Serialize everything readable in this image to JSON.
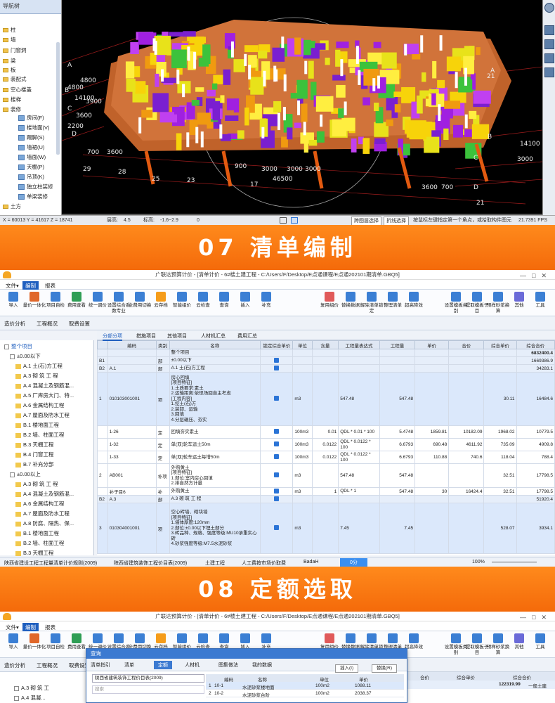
{
  "section1": {
    "nav_title": "导航树",
    "nav_items": [
      "柱",
      "墙",
      "门窗洞",
      "梁",
      "板",
      "装配式",
      "空心楼盖",
      "楼梯",
      "装修",
      "土方"
    ],
    "nav_sub_items": [
      "房间(F)",
      "楼地面(V)",
      "踢脚(S)",
      "墙裙(U)",
      "墙面(W)",
      "天棚(P)",
      "吊顶(K)",
      "独立柱装修",
      "单梁装修"
    ],
    "axis_labels": [
      "A",
      "B",
      "C",
      "D",
      "A",
      "B",
      "C",
      "D",
      "21",
      "21",
      "29",
      "28",
      "25",
      "23",
      "17",
      "700",
      "3600",
      "3600",
      "700",
      "900",
      "3000",
      "3000",
      "3000",
      "46500",
      "14100",
      "14100",
      "4800",
      "3900",
      "2200",
      "3600",
      "3000",
      "4800"
    ],
    "status": {
      "coords": "X = 60013 Y = 41617 Z = 18741",
      "floor_height_label": "层高:",
      "floor_height": "4.5",
      "elevation_label": "标高:",
      "elevation": "-1.6~2.9",
      "zero": "0",
      "btn1": "跨图层选择",
      "btn2": "折线选择",
      "hint": "按鼠标左键指定第一个角点，或拾取构件图元",
      "fps": "21.7391 FPS"
    }
  },
  "banner1": "07  清单编制",
  "banner2": "08  定额选取",
  "app": {
    "title": "广联达预算计价 - [清单计价 - 6#楼土建工程 - C:/Users/F/Desktop/E点通课程/E点通202101期清单.GBQ5]",
    "menus": [
      "文件▾",
      "编制",
      "报表"
    ],
    "ribbon": [
      "导入",
      "量价一体化",
      "项目自检",
      "费用查看",
      "统一调价",
      "设置综合系数专业",
      "全费用切换",
      "云存档",
      "智能组价",
      "云检查",
      "查询",
      "插入",
      "补充",
      "",
      "",
      "复用组价",
      "替换数据",
      "解除清单锁定",
      "整理清单",
      "超高降效",
      "",
      "设置模板类别",
      "提取模板子目",
      "预样砂浆换算",
      "其他",
      "工具"
    ],
    "subtabs": [
      "造价分析",
      "工程概况",
      "取费设置"
    ],
    "grid_tabs": [
      "分部分项",
      "措施项目",
      "其他项目",
      "人材机汇总",
      "费用汇总"
    ],
    "tree": [
      "整个项目",
      "±0.00以下",
      "A.1 土(石)方工程",
      "A.3 砌 筑 工 程",
      "A.4 混凝土及钢筋混...",
      "A.5 厂库房大门、特...",
      "A.6 金属结构工程",
      "A.7 屋面及防水工程",
      "B.1 楼地面工程",
      "B.2 墙、柱面工程",
      "B.3 天棚工程",
      "B.4 门窗工程",
      "B.7 补充分部",
      "±0.00以上",
      "A.3 砌 筑 工 程",
      "A.4 混凝土及钢筋混...",
      "A.6 金属结构工程",
      "A.7 屋面及防水工程",
      "A.8 防腐、隔热、保...",
      "B.1 楼地面工程",
      "B.2 墙、柱面工程",
      "B.3 天棚工程"
    ],
    "columns": [
      "编码",
      "类别",
      "名称",
      "锁定综合单价",
      "单位",
      "含量",
      "工程量表达式",
      "工程量",
      "单价",
      "合价",
      "综合单价",
      "综合合价"
    ],
    "rows": [
      {
        "no": "",
        "code": "",
        "type": "",
        "name": "整个项目",
        "unit": "",
        "qty_expr": "",
        "qty": "",
        "price": "",
        "sum": "",
        "uprice": "",
        "total": "6832400.4",
        "cls": "sec"
      },
      {
        "no": "B1",
        "code": "",
        "type": "部",
        "name": "±0.00以下",
        "unit": "",
        "qty_expr": "",
        "qty": "",
        "price": "",
        "sum": "",
        "uprice": "",
        "total": "1669386.9",
        "cls": "sec"
      },
      {
        "no": "B2",
        "code": "A.1",
        "type": "部",
        "name": "A.1  土(石)方工程",
        "unit": "",
        "qty_expr": "",
        "qty": "",
        "price": "",
        "sum": "",
        "uprice": "",
        "total": "34283.1",
        "cls": "sec"
      },
      {
        "no": "1",
        "code": "010103001001",
        "type": "项",
        "name": "房心回填\n[项目特征]\n1.土质要求:素土\n2.运输距离:依现场回自主考虑\n[工程内容]\n1.挖土(石)方\n2.装卸、运输\n3.回填\n4.分层碾压、夯实",
        "unit": "m3",
        "qty_expr": "547.48",
        "qty": "547.48",
        "price": "",
        "sum": "",
        "uprice": "30.11",
        "total": "16484.6",
        "cls": "hl"
      },
      {
        "no": "",
        "code": "1-26",
        "type": "定",
        "name": "回填夯实素土",
        "unit": "100m3",
        "content": "0.01",
        "qty_expr": "QDL * 0.01 * 100",
        "qty": "5.4748",
        "price": "1859.81",
        "sum": "10182.09",
        "uprice": "1968.02",
        "total": "10779.5",
        "cls": ""
      },
      {
        "no": "",
        "code": "1-32",
        "type": "定",
        "name": "单(双)轮车运土50m",
        "unit": "100m3",
        "content": "0.0122",
        "qty_expr": "QDL * 0.0122 * 100",
        "qty": "6.6793",
        "price": "690.48",
        "sum": "4611.92",
        "uprice": "735.09",
        "total": "4909.8",
        "cls": ""
      },
      {
        "no": "",
        "code": "1-33",
        "type": "定",
        "name": "单(双)轮车运土每增50m",
        "unit": "100m3",
        "content": "0.0122",
        "qty_expr": "QDL * 0.0122 * 100",
        "qty": "6.6793",
        "price": "110.88",
        "sum": "740.6",
        "uprice": "118.04",
        "total": "788.4",
        "cls": ""
      },
      {
        "no": "2",
        "code": "AB001",
        "type": "补项",
        "name": "外购黄土\n[项目特征]\n1.部位:室内房心回填\n2.排自然方计量",
        "unit": "m3",
        "qty_expr": "547.48",
        "qty": "547.48",
        "price": "",
        "sum": "",
        "uprice": "32.51",
        "total": "17798.5",
        "cls": ""
      },
      {
        "no": "",
        "code": "补子目6",
        "type": "补",
        "name": "外购黄土",
        "unit": "m3",
        "content": "1",
        "qty_expr": "QDL * 1",
        "qty": "547.48",
        "price": "30",
        "sum": "16424.4",
        "uprice": "32.51",
        "total": "17798.5",
        "cls": ""
      },
      {
        "no": "B2",
        "code": "A.3",
        "type": "部",
        "name": "A.3 砌 筑 工 程",
        "unit": "",
        "qty_expr": "",
        "qty": "",
        "price": "",
        "sum": "",
        "uprice": "",
        "total": "51920.4",
        "cls": "sec"
      },
      {
        "no": "3",
        "code": "010304001001",
        "type": "项",
        "name": "空心砖墙、砌块墙\n[项目特征]\n1.墙体厚度:120mm\n2.部位:±0.00以下埋土部分\n3.砖品种、规格、强度等级:MU10承重实心砖\n4.砂浆强度等级:M7.5水泥砂浆",
        "unit": "m3",
        "qty_expr": "7.45",
        "qty": "7.45",
        "price": "",
        "sum": "",
        "uprice": "528.07",
        "total": "3934.1",
        "cls": "hl"
      }
    ],
    "bottom": [
      "陕西省建设工程工程量清单计价规则(2009)",
      "陕西省建筑装饰工程价目表(2009)",
      "土建工程",
      "人工费按市场价取费",
      "BadaH",
      "0分",
      "100%"
    ]
  },
  "app2": {
    "dialog_title": "查询",
    "dialog_tabs": [
      "清单指引",
      "清单",
      "定额",
      "人材机",
      "图集做法",
      "我的数据"
    ],
    "dialog_buttons": [
      "插入(I)",
      "替换(R)"
    ],
    "dialog_select": "陕西省建筑装饰工程价目表(2009)",
    "dialog_search": "搜索",
    "dialog_columns": [
      "编码",
      "名称",
      "单位",
      "单价"
    ],
    "dialog_rows": [
      {
        "idx": "1",
        "code": "10-1",
        "name": "水泥砂浆楼地面",
        "unit": "100m2",
        "price": "1088.11"
      },
      {
        "idx": "2",
        "code": "10-2",
        "name": "水泥砂浆台阶",
        "unit": "100m2",
        "price": "2038.37"
      }
    ],
    "behind_total": "122319.99",
    "behind_label": "一般土建",
    "tree": [
      "A.3 砌 筑 工",
      "A.4 混凝..."
    ],
    "right_cols": [
      "合价",
      "综合单价",
      "综合合价"
    ]
  }
}
